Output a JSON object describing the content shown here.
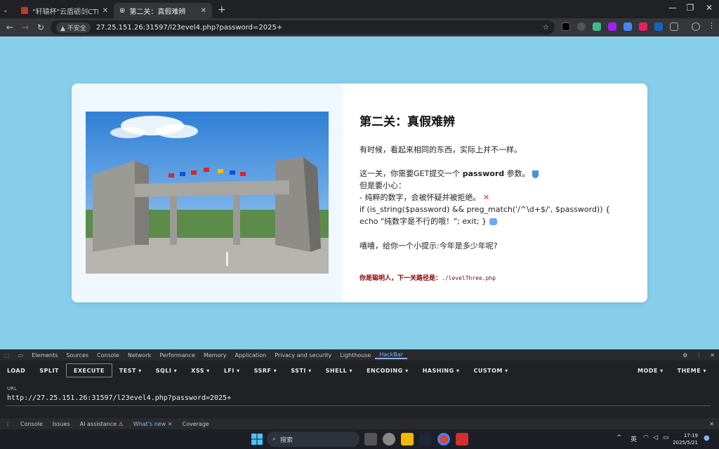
{
  "browser": {
    "tabs": [
      {
        "label": "\"轩辕杯\"云盾砺剑CTF挑战赛",
        "active": false
      },
      {
        "label": "第二关：真假难辨",
        "active": true
      }
    ],
    "new_tab": "+",
    "window_controls": {
      "minimize": "—",
      "restore": "❐",
      "close": "✕"
    },
    "security_label": "不安全",
    "url": "27.25.151.26:31597/l23evel4.php?password=2025+"
  },
  "page": {
    "title": "第二关：真假难辨",
    "intro": "有时候，看起来相同的东西，实际上并不一样。",
    "task_prefix": "这一关，你需要GET提交一个 ",
    "task_param": "password",
    "task_suffix": " 参数。",
    "careful": "但是要小心：",
    "rule": "- 纯粹的数字，会被怀疑并被拒绝。",
    "code": "if (is_string($password) && preg_match('/^\\d+$/', $password)) { echo \"纯数字是不行的哦！\"; exit; }",
    "tip": "嘻嘻，给你一个小提示:今年是多少年呢?",
    "hint_label": "你是聪明人，下一关路径是：",
    "hint_path": "./levelThree.php"
  },
  "devtools": {
    "tabs": [
      "Elements",
      "Sources",
      "Console",
      "Network",
      "Performance",
      "Memory",
      "Application",
      "Privacy and security",
      "Lighthouse",
      "HackBar"
    ],
    "active_tab": "HackBar",
    "hackbar_buttons": [
      "LOAD",
      "SPLIT",
      "EXECUTE",
      "TEST ▾",
      "SQLI ▾",
      "XSS ▾",
      "LFI ▾",
      "SSRF ▾",
      "SSTI ▾",
      "SHELL ▾",
      "ENCODING ▾",
      "HASHING ▾",
      "CUSTOM ▾"
    ],
    "hackbar_right": [
      "MODE ▾",
      "THEME ▾"
    ],
    "url_label": "URL",
    "url_value": "http://27.25.151.26:31597/l23evel4.php?password=2025+",
    "drawer_tabs": [
      "Console",
      "Issues",
      "AI assistance ⚠",
      "What's new ✕",
      "Coverage"
    ]
  },
  "taskbar": {
    "search_placeholder": "搜索",
    "ime": "英",
    "time": "17:19",
    "date": "2025/5/21"
  },
  "colors": {
    "page_bg": "#87ceeb",
    "hint_red": "#8b0000",
    "card_left": "#f0f8ff"
  }
}
